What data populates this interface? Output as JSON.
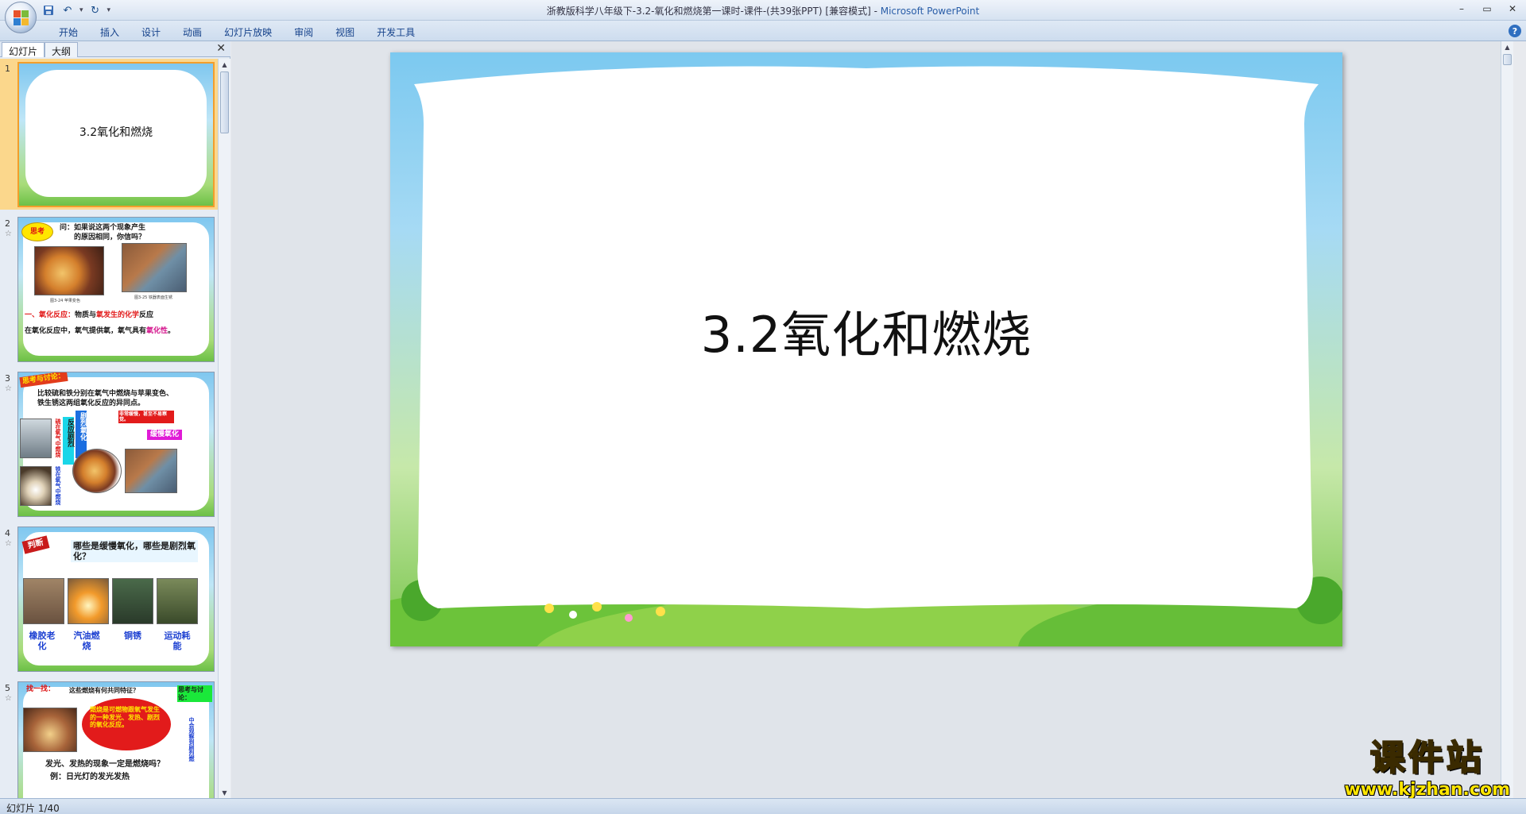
{
  "titlebar": {
    "title": "浙教版科学八年级下-3.2-氧化和燃烧第一课时-课件-(共39张PPT) [兼容模式] - ",
    "app_name": "Microsoft PowerPoint"
  },
  "ribbon": {
    "tabs": [
      "开始",
      "插入",
      "设计",
      "动画",
      "幻灯片放映",
      "审阅",
      "视图",
      "开发工具"
    ]
  },
  "pane": {
    "tab_slides": "幻灯片",
    "tab_outline": "大纲"
  },
  "thumbnails": [
    {
      "num": "1",
      "title": "3.2氧化和燃烧"
    },
    {
      "num": "2",
      "badge": "思考",
      "question_line1": "问：如果说这两个现象产生",
      "question_line2": "的原因相同，你信吗？",
      "caption1": "图3-24  苹果变色",
      "caption2": "图3-25  铁器表面生锈",
      "definition_lead": "一、氧化反应：",
      "definition_body": "物质与",
      "definition_red": "氧发生的化学",
      "definition_end": "反应",
      "line2_a": "在氧化反应中，氧气提供氧，氧气具有",
      "line2_b": "氧化性",
      "line2_end": "。"
    },
    {
      "num": "3",
      "badge": "思考与讨论：",
      "text_line1": "比较硫和铁分别在氧气中燃烧与苹果变色、",
      "text_line2": "铁生锈这两组氧化反应的异同点。",
      "label_fast": "反应剧烈",
      "label_violent": "剧烈氧化",
      "label_red": "非常缓慢，甚至不易察觉。",
      "label_slow": "缓慢氧化",
      "vert1": "硫在氧气中燃烧",
      "vert2": "铁在氧气中燃烧"
    },
    {
      "num": "4",
      "badge": "判断",
      "question": "哪些是缓慢氧化，哪些是剧烈氧化？",
      "items": [
        "橡胶老化",
        "汽油燃烧",
        "铜锈",
        "运动耗能"
      ]
    },
    {
      "num": "5",
      "header": "找一找：",
      "question": "这些燃烧有何共同特征？",
      "bubble": "燃烧是可燃物跟氧气发生的一种发光、发热、剧烈的氧化反应。",
      "side_label": "思考与讨论：",
      "side_vert": "中会观察到剧烈燃",
      "bottom_q": "发光、发热的现象一定是燃烧吗？",
      "bottom_ex": "例：日光灯的发光发热"
    }
  ],
  "slide": {
    "title": "3.2氧化和燃烧"
  },
  "watermark": {
    "chinese": "课件站",
    "url": "www.kjzhan.com"
  },
  "status": {
    "text": "幻灯片 1/40"
  }
}
